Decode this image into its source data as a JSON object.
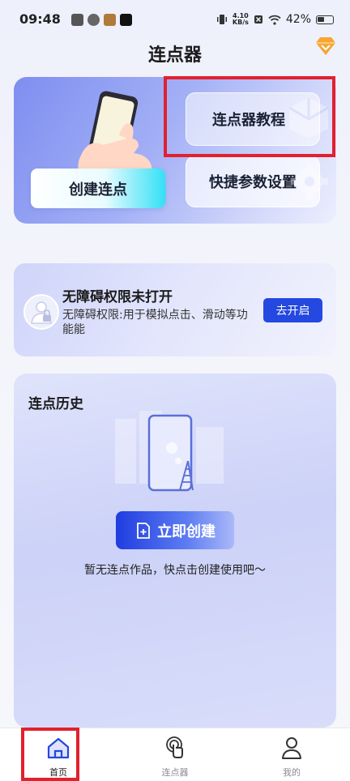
{
  "status_bar": {
    "time": "09:48",
    "net_speed_value": "4.10",
    "net_speed_unit": "KB/s",
    "battery": "42%"
  },
  "header": {
    "title": "连点器",
    "vip_icon": "diamond-icon"
  },
  "top_card": {
    "create_label": "创建连点",
    "tutorial_label": "连点器教程",
    "quick_settings_label": "快捷参数设置"
  },
  "accessibility": {
    "title": "无障碍权限未打开",
    "description": "无障碍权限:用于模拟点击、滑动等功能能",
    "button_label": "去开启"
  },
  "history": {
    "title": "连点历史",
    "create_button_label": "立即创建",
    "empty_text": "暂无连点作品，快点击创建使用吧～"
  },
  "bottom_nav": {
    "items": [
      {
        "label": "首页",
        "icon": "home-icon",
        "active": true
      },
      {
        "label": "连点器",
        "icon": "tap-finger-icon",
        "active": false
      },
      {
        "label": "我的",
        "icon": "person-icon",
        "active": false
      }
    ]
  },
  "colors": {
    "accent": "#2448e0",
    "highlight_frame": "#e2202e"
  }
}
